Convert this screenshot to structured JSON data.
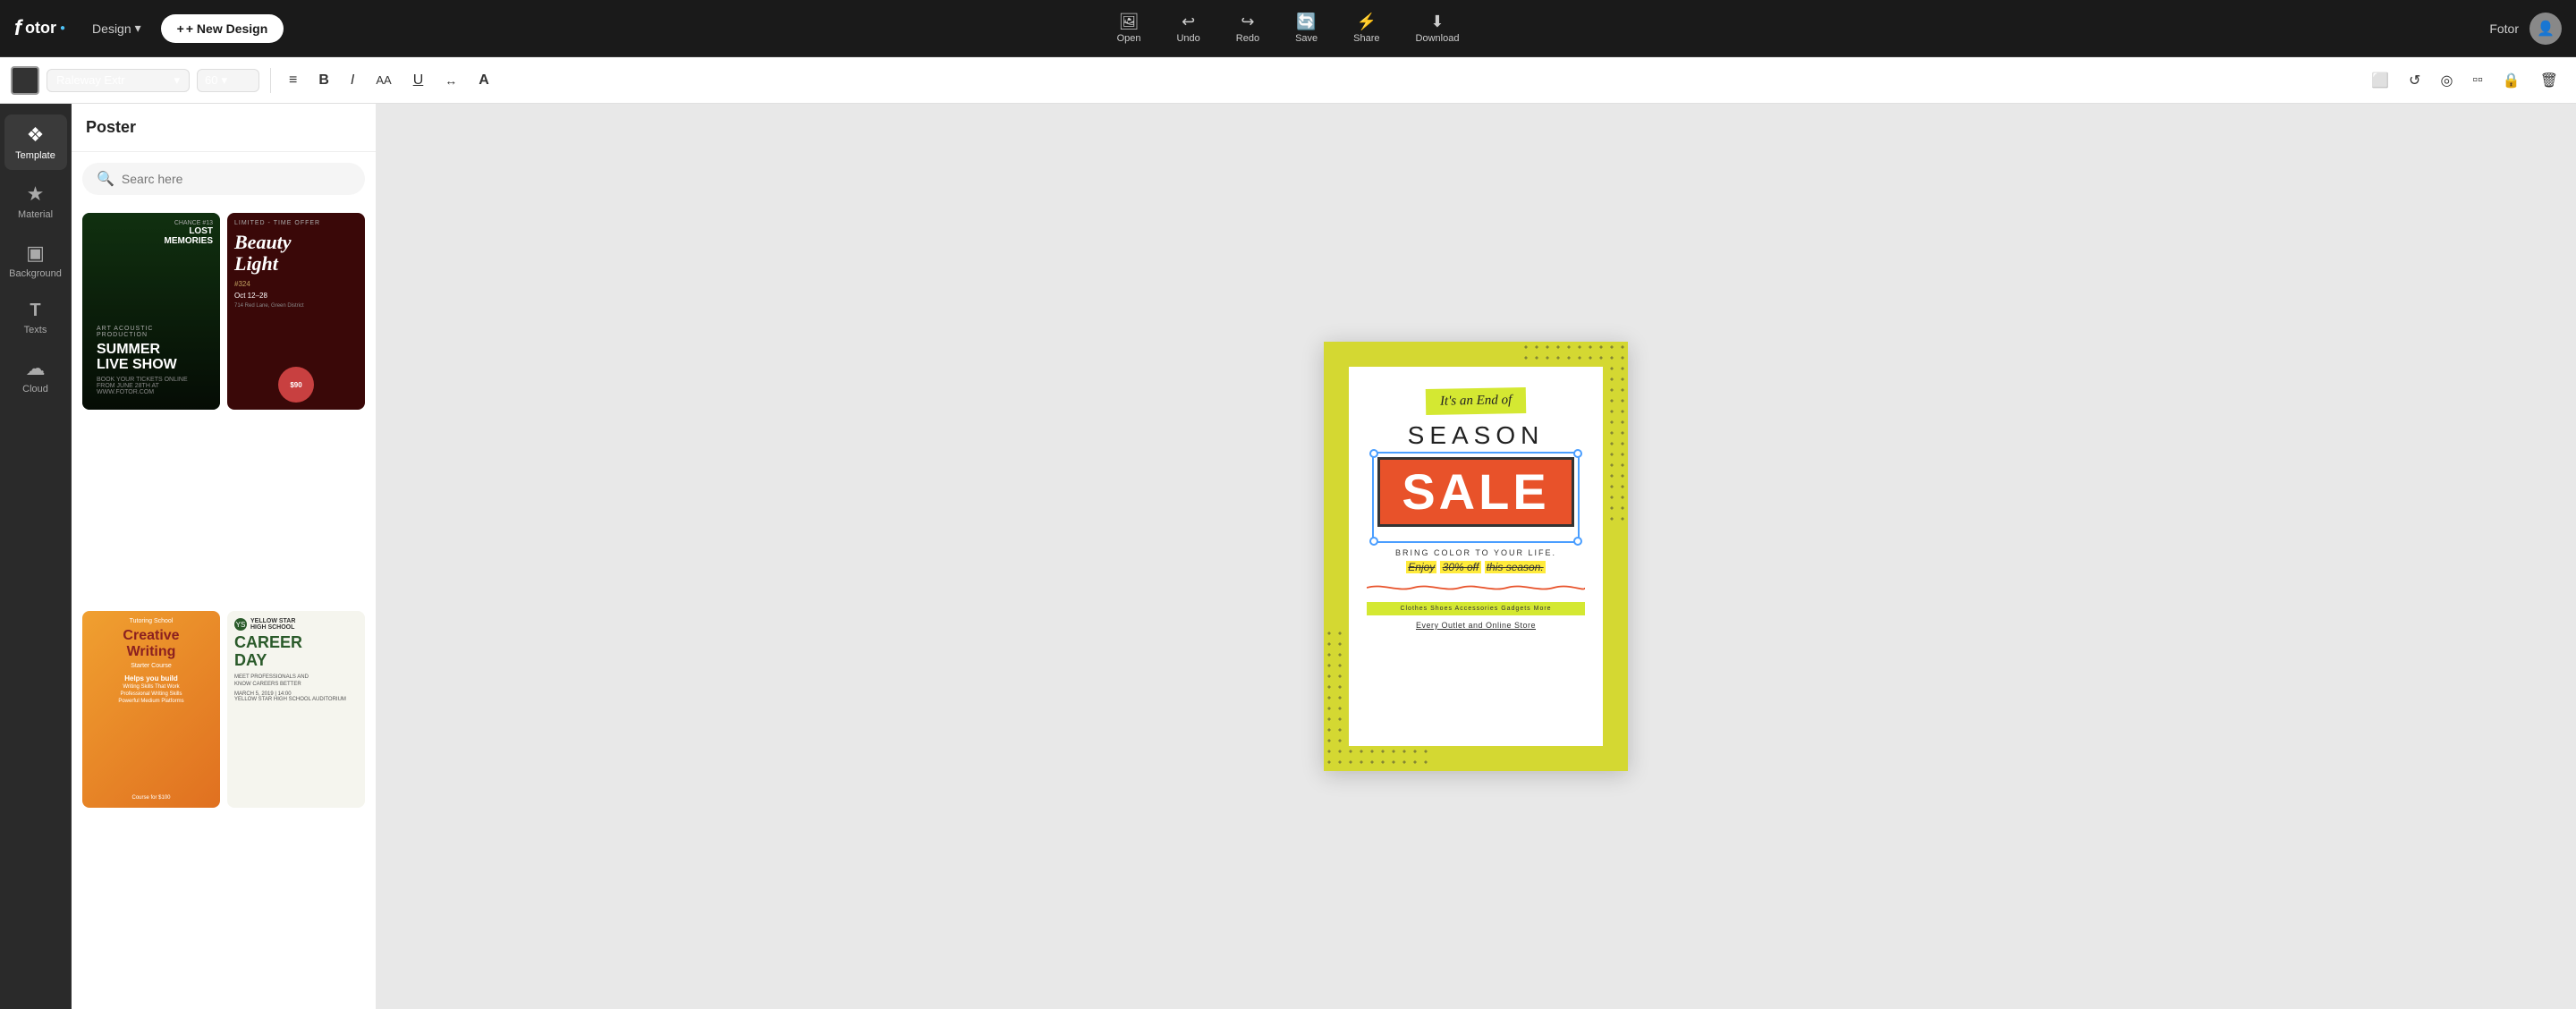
{
  "app": {
    "name": "Fotor",
    "logo_text": "fotor"
  },
  "topnav": {
    "design_label": "Design",
    "new_design_label": "+ New Design",
    "actions": [
      {
        "id": "open",
        "label": "Open",
        "icon": "⬛"
      },
      {
        "id": "undo",
        "label": "Undo",
        "icon": "↩"
      },
      {
        "id": "redo",
        "label": "Redo",
        "icon": "↪"
      },
      {
        "id": "save",
        "label": "Save",
        "icon": "♻"
      },
      {
        "id": "share",
        "label": "Share",
        "icon": "🔗"
      },
      {
        "id": "download",
        "label": "Download",
        "icon": "⬇"
      }
    ],
    "user_name": "Fotor"
  },
  "toolbar": {
    "font_family": "Raleway Extr",
    "font_size": "60",
    "align_icon": "≡",
    "bold_label": "B",
    "italic_label": "I",
    "size_aa": "AA",
    "underline": "U",
    "spacing": "↔",
    "case": "A",
    "right_icons": [
      "⬜",
      "↺",
      "◎",
      "◫",
      "🔒",
      "🗑"
    ]
  },
  "sidebar": {
    "items": [
      {
        "id": "template",
        "label": "Template",
        "icon": "❖"
      },
      {
        "id": "material",
        "label": "Material",
        "icon": "★"
      },
      {
        "id": "background",
        "label": "Background",
        "icon": "▣"
      },
      {
        "id": "texts",
        "label": "Texts",
        "icon": "T"
      },
      {
        "id": "cloud",
        "label": "Cloud",
        "icon": "☁"
      }
    ]
  },
  "left_panel": {
    "header": "Poster",
    "search_placeholder": "Searc here",
    "templates": [
      {
        "id": "summer",
        "title": "SUMMER LIVE SHOW",
        "subtitle": "LOST MEMORIES",
        "bg_color": "#1a3d20"
      },
      {
        "id": "beauty",
        "title": "Beauty Light",
        "subtitle": "LIMITED TIME OFFER",
        "bg_color": "#3d0808"
      },
      {
        "id": "creative",
        "title": "Creative Writing",
        "subtitle": "Tutoring School",
        "bg_color": "#e07820"
      },
      {
        "id": "career",
        "title": "CAREER DAY",
        "subtitle": "Yellow Star High School",
        "bg_color": "#f5f5f0"
      }
    ]
  },
  "poster": {
    "badge_text": "It's an End of",
    "season_text": "SEASON",
    "sale_text": "SALE",
    "bring_color": "BRING COLOR TO YOUR LIFE.",
    "enjoy_text": "Enjoy",
    "discount": "30% off",
    "this_season": "this season.",
    "bottom_bar": "Clothes  Shoes  Accessories  Gadgets  More",
    "every_outlet": "Every Outlet and Online Store"
  },
  "colors": {
    "poster_yellow": "#d4d832",
    "poster_red": "#e8522a",
    "poster_white": "#ffffff",
    "poster_dark": "#222222",
    "accent_blue": "#4a9eff"
  }
}
